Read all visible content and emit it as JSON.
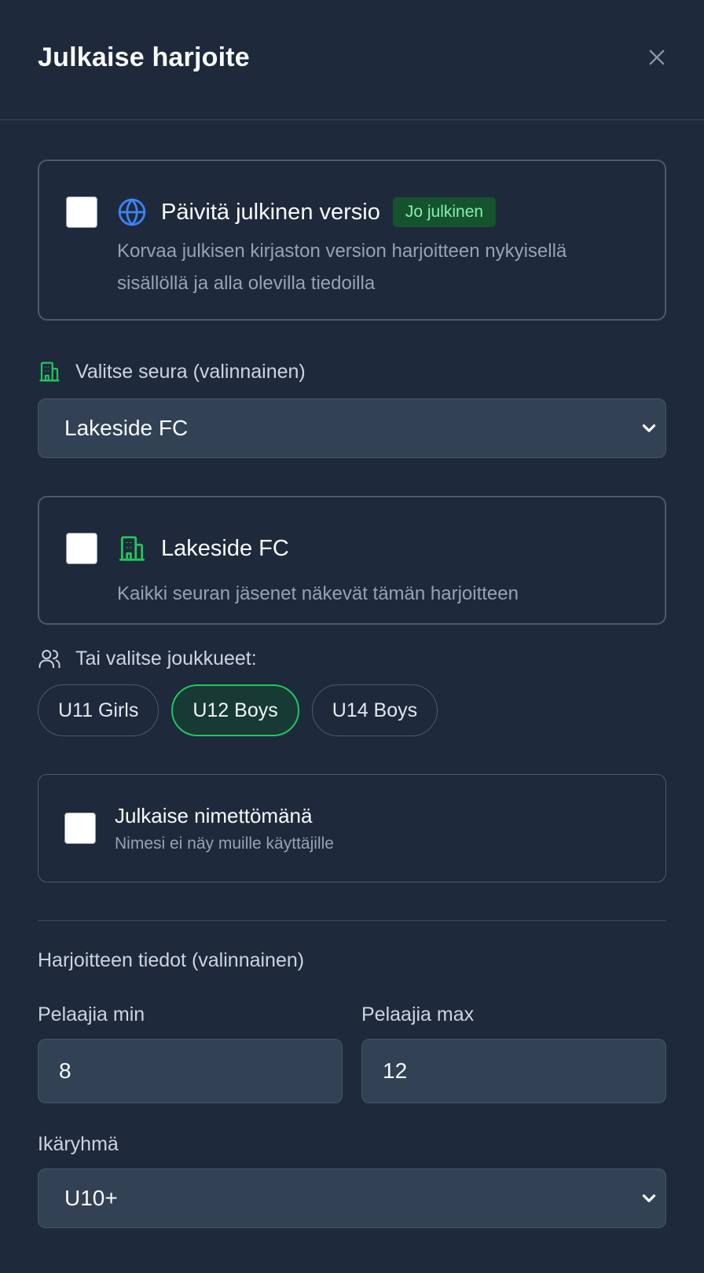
{
  "header": {
    "title": "Julkaise harjoite"
  },
  "public_version": {
    "title": "Päivitä julkinen versio",
    "badge": "Jo julkinen",
    "description": "Korvaa julkisen kirjaston version harjoitteen nykyisellä sisällöllä ja alla olevilla tiedoilla",
    "checked": false
  },
  "club_select": {
    "label": "Valitse seura (valinnainen)",
    "value": "Lakeside FC"
  },
  "club_card": {
    "title": "Lakeside FC",
    "description": "Kaikki seuran jäsenet näkevät tämän harjoitteen",
    "checked": false
  },
  "teams": {
    "label": "Tai valitse joukkueet:",
    "items": [
      {
        "label": "U11 Girls",
        "selected": false
      },
      {
        "label": "U12 Boys",
        "selected": true
      },
      {
        "label": "U14 Boys",
        "selected": false
      }
    ]
  },
  "anonymous": {
    "title": "Julkaise nimettömänä",
    "description": "Nimesi ei näy muille käyttäjille",
    "checked": false
  },
  "details": {
    "section_title": "Harjoitteen tiedot (valinnainen)",
    "players_min_label": "Pelaajia min",
    "players_min_value": "8",
    "players_max_label": "Pelaajia max",
    "players_max_value": "12",
    "age_group_label": "Ikäryhmä",
    "age_group_value": "U10+"
  },
  "colors": {
    "background": "#1e293b",
    "input_bg": "#334155",
    "accent_green": "#22c55e",
    "globe_blue": "#3b82f6",
    "badge_bg": "#14532d"
  },
  "icons": {
    "close": "close-icon",
    "globe": "globe-icon",
    "building": "building-icon",
    "users": "users-icon",
    "chevron": "chevron-down-icon"
  }
}
